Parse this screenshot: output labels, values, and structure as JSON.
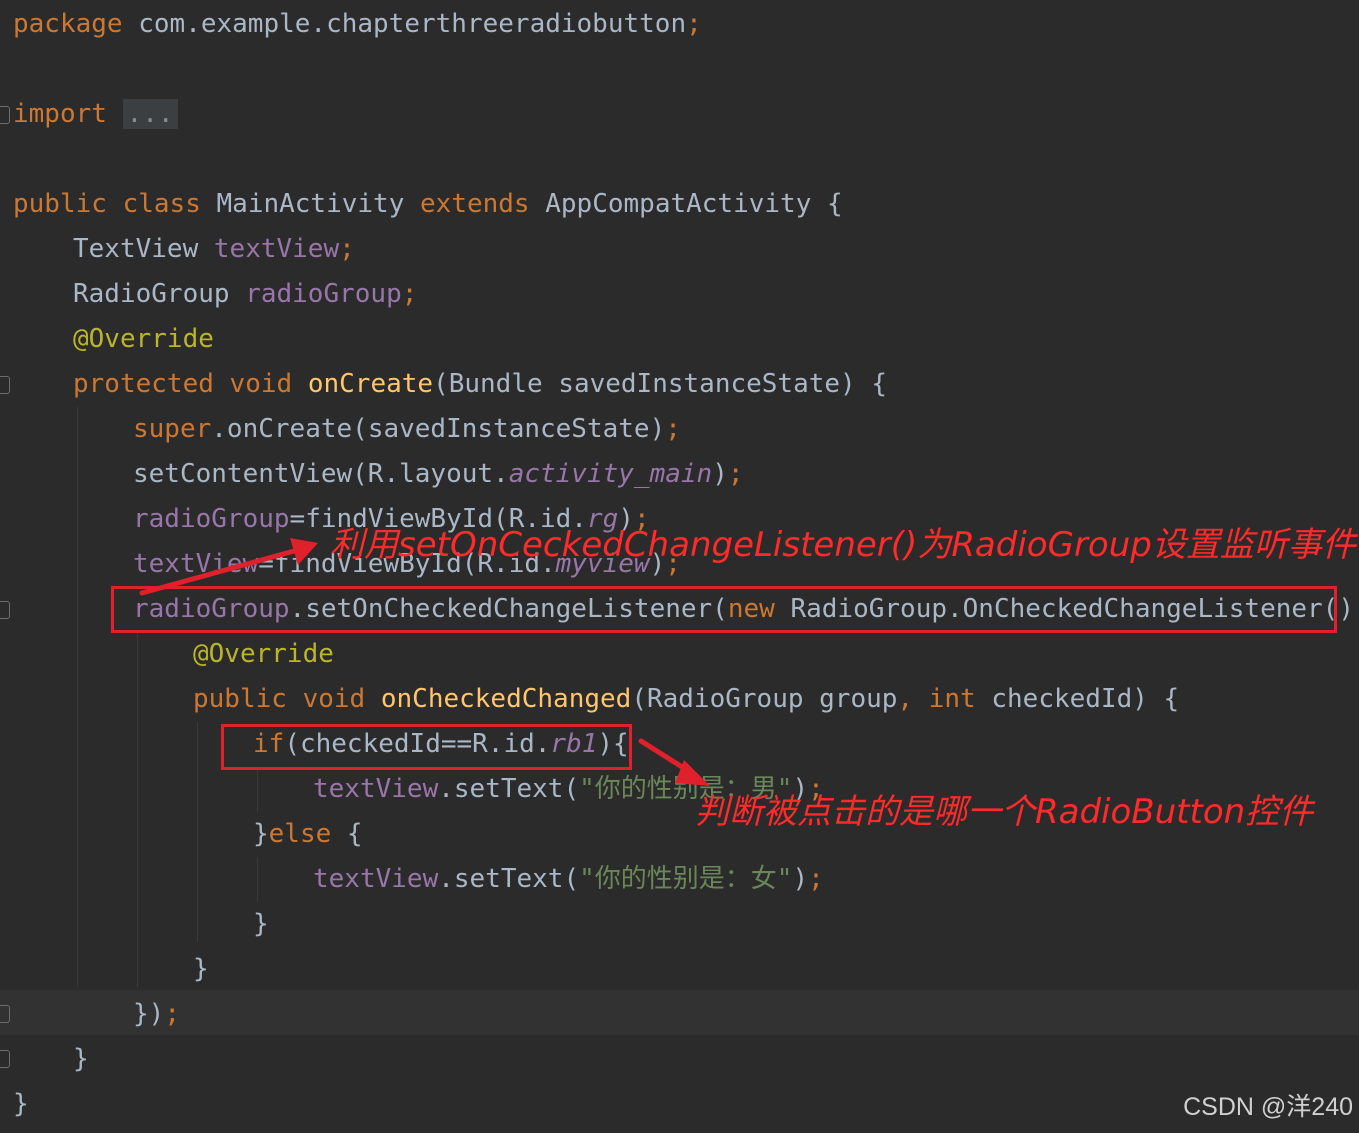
{
  "code": {
    "l1": {
      "t1": "package",
      "t2": " com.example.chapterthreeradiobutton",
      "t3": ";"
    },
    "l2": {
      "t1": "import",
      "t2": " ",
      "t3": "..."
    },
    "l3": {
      "t1": "public",
      "t2": " ",
      "t3": "class",
      "t4": " MainActivity ",
      "t5": "extends",
      "t6": " AppCompatActivity {"
    },
    "l4": {
      "t1": "TextView ",
      "t2": "textView",
      "t3": ";"
    },
    "l5": {
      "t1": "RadioGroup ",
      "t2": "radioGroup",
      "t3": ";"
    },
    "l6": {
      "t1": "@Override"
    },
    "l7": {
      "t1": "protected",
      "t2": " ",
      "t3": "void",
      "t4": " ",
      "t5": "onCreate",
      "t6": "(Bundle savedInstanceState) {"
    },
    "l8": {
      "t1": "super",
      "t2": ".onCreate(savedInstanceState)",
      "t3": ";"
    },
    "l9": {
      "t1": "setContentView(R.layout.",
      "t2": "activity_main",
      "t3": ")",
      "t4": ";"
    },
    "l10": {
      "t1": "radioGroup",
      "t2": "=findViewById(R.id.",
      "t3": "rg",
      "t4": ")",
      "t5": ";"
    },
    "l11": {
      "t1": "textView",
      "t2": "=findViewById(R.id.",
      "t3": "myview",
      "t4": ")",
      "t5": ";"
    },
    "l12": {
      "t1": "radioGroup",
      "t2": ".setOnCheckedChangeListener(",
      "t3": "new",
      "t4": " RadioGroup.OnCheckedChangeListener() {"
    },
    "l13": {
      "t1": "@Override"
    },
    "l14": {
      "t1": "public",
      "t2": " ",
      "t3": "void",
      "t4": " ",
      "t5": "onCheckedChanged",
      "t6": "(RadioGroup group",
      "t7": ", ",
      "t8": "int",
      "t9": " checkedId) {"
    },
    "l15": {
      "t1": "if",
      "t2": "(checkedId==R.id.",
      "t3": "rb1",
      "t4": "){"
    },
    "l16": {
      "t1": "textView",
      "t2": ".setText(",
      "t3": "\"你的性别是：男\"",
      "t4": ")",
      "t5": ";"
    },
    "l17": {
      "t1": "}",
      "t2": "else",
      "t3": " {"
    },
    "l18": {
      "t1": "textView",
      "t2": ".setText(",
      "t3": "\"你的性别是：女\"",
      "t4": ")",
      "t5": ";"
    },
    "l19": {
      "t1": "}"
    },
    "l20": {
      "t1": "}"
    },
    "l21": {
      "t1": "})",
      "t2": ";"
    },
    "l22": {
      "t1": "}"
    },
    "l23": {
      "t1": "}"
    }
  },
  "annotations": {
    "listener_note": "利用setOnCeckedChangeListener()为RadioGroup设置监听事件",
    "button_note": "判断被点击的是哪一个RadioButton控件",
    "color": "#e0202a"
  },
  "watermark": "CSDN @洋240",
  "colors": {
    "background": "#2b2b2b",
    "keyword": "#cc7832",
    "annotation": "#bbb529",
    "field": "#9876aa",
    "method": "#ffc66d",
    "string": "#6a8759",
    "text": "#a9b7c6"
  }
}
